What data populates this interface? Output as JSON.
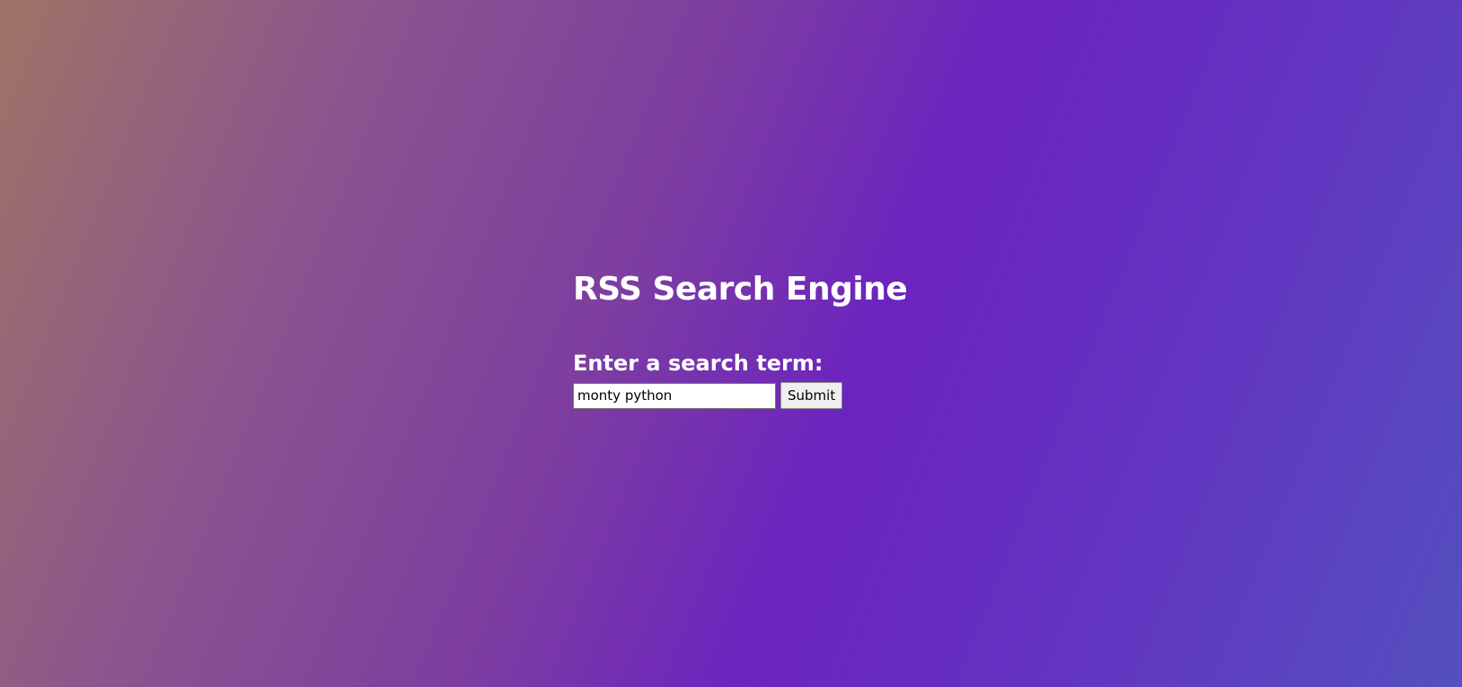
{
  "page": {
    "title": "RSS Search Engine"
  },
  "search": {
    "label": "Enter a search term:",
    "value": "monty python",
    "submit_label": "Submit"
  },
  "colors": {
    "background_start": "#9e7466",
    "background_mid": "#6c24bf",
    "background_end": "#5450bf",
    "text": "#ffffff"
  }
}
